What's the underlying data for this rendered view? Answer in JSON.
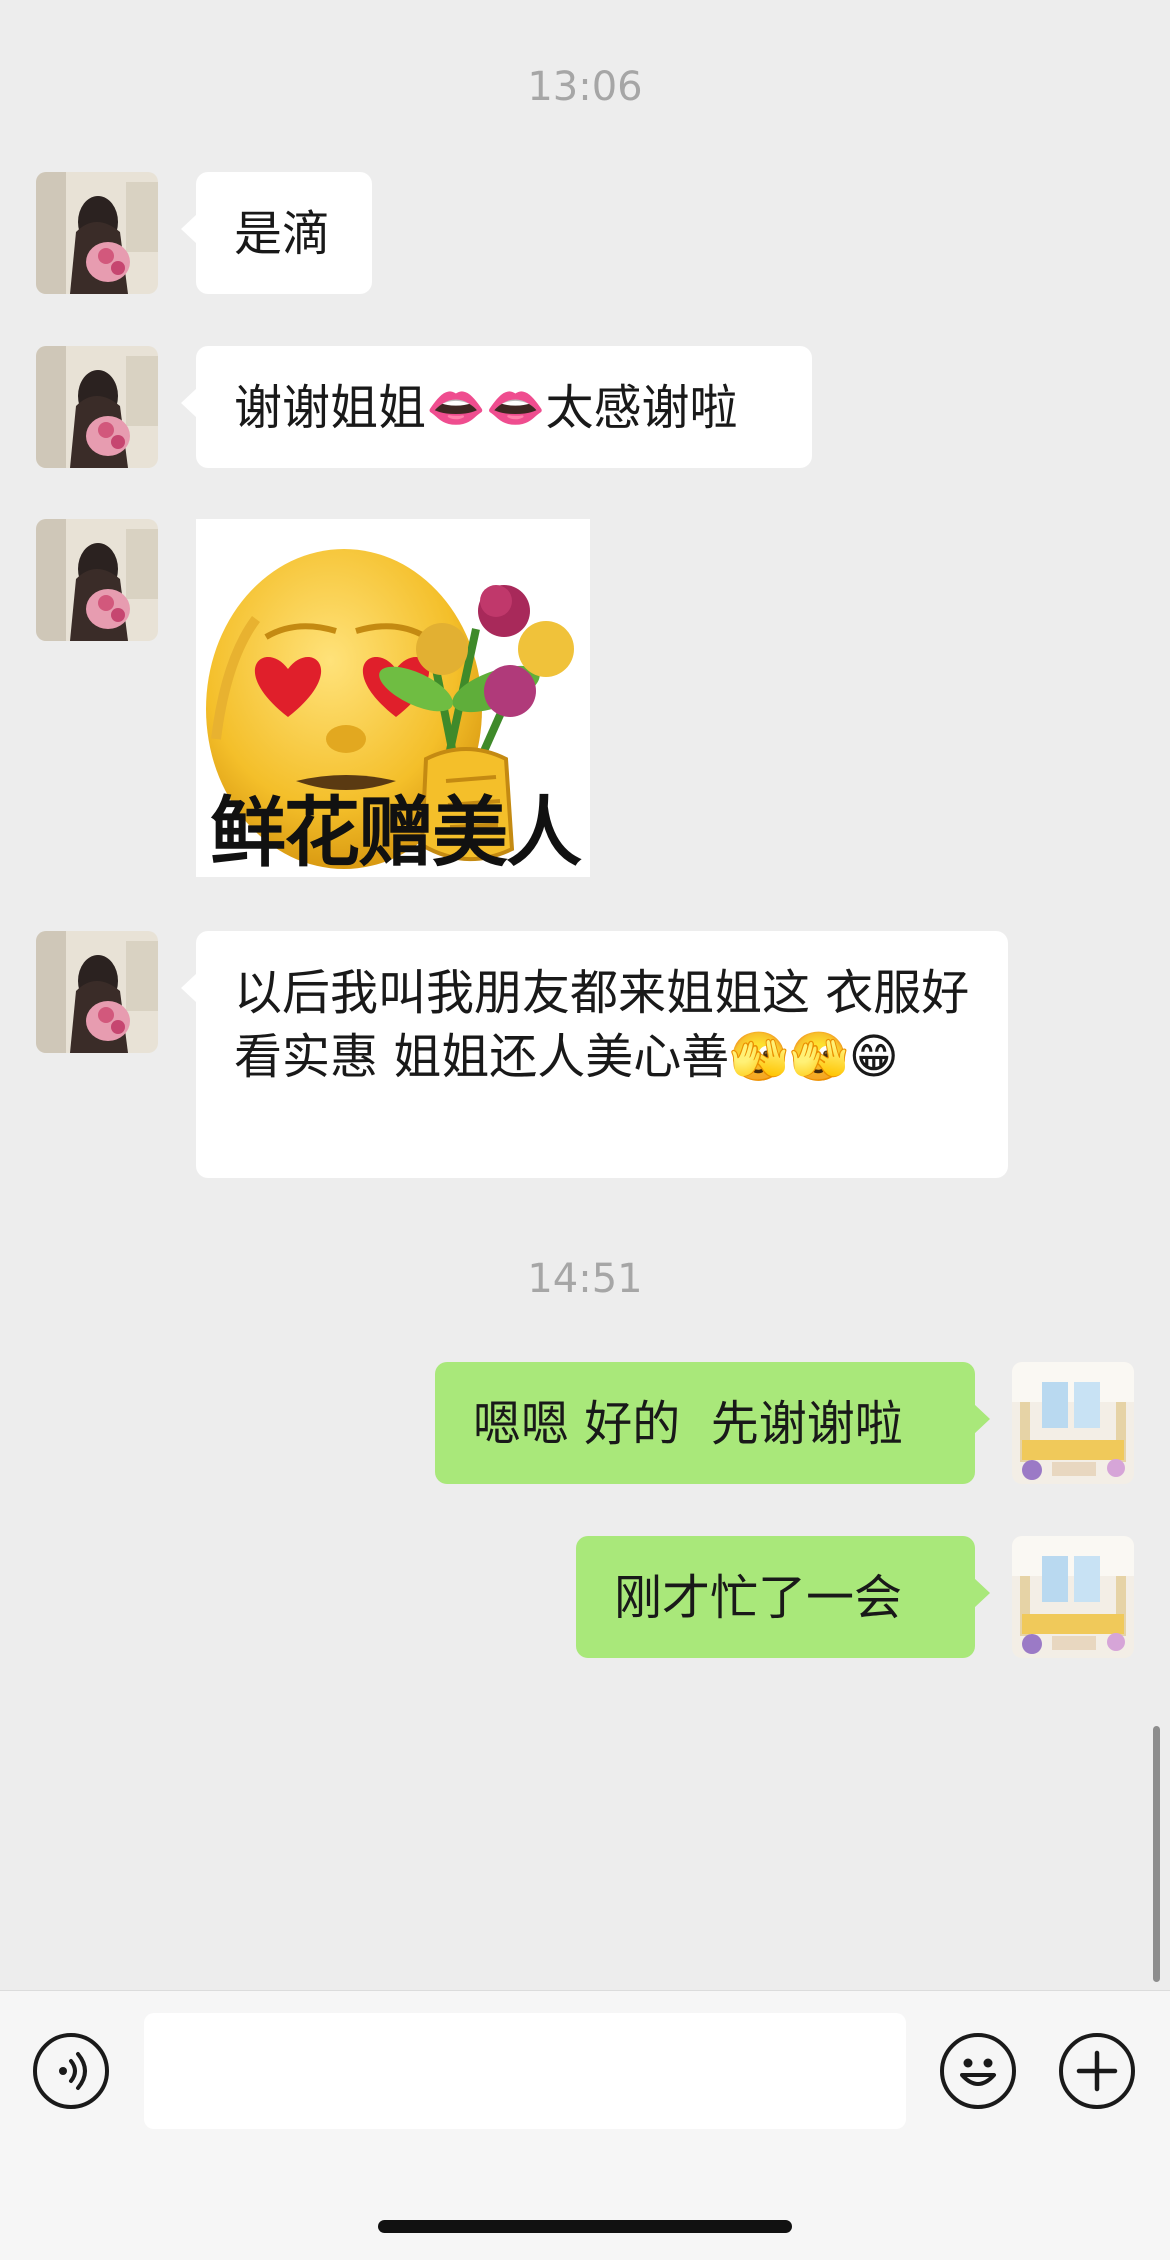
{
  "timestamps": [
    "13:06",
    "14:51"
  ],
  "messages": [
    {
      "sender": "contact",
      "type": "text",
      "text": "是滴"
    },
    {
      "sender": "contact",
      "type": "text",
      "text": "谢谢姐姐👄👄太感谢啦"
    },
    {
      "sender": "contact",
      "type": "sticker",
      "caption": "鲜花赠美人",
      "icon": "old-man-heart-eyes-flowers-sticker"
    },
    {
      "sender": "contact",
      "type": "text",
      "text": "以后我叫我朋友都来姐姐这 衣服好看实惠 姐姐还人美心善🫣🫣😁"
    },
    {
      "sender": "self",
      "type": "text",
      "text": "嗯嗯 好的  先谢谢啦"
    },
    {
      "sender": "self",
      "type": "text",
      "text": "刚才忙了一会"
    }
  ],
  "input_bar": {
    "voice_icon": "voice-icon",
    "text_value": "",
    "emoji_icon": "emoji-icon",
    "more_icon": "plus-icon"
  },
  "colors": {
    "background": "#ededed",
    "incoming_bubble": "#ffffff",
    "outgoing_bubble": "#a9e87a",
    "timestamp": "#a6a6a6"
  }
}
